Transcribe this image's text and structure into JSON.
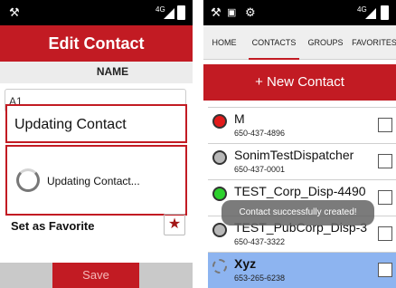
{
  "left_screen": {
    "status": {
      "app_icon": "tool-icon",
      "network": "4G"
    },
    "header_title": "Edit Contact",
    "section_label": "NAME",
    "name_field_value": "A1",
    "dialog": {
      "title": "Updating Contact",
      "message": "Updating Contact..."
    },
    "favorite_label": "Set as Favorite",
    "save_label": "Save"
  },
  "right_screen": {
    "status": {
      "network": "4G"
    },
    "tabs": [
      "HOME",
      "CONTACTS",
      "GROUPS",
      "FAVORITES"
    ],
    "active_tab": "CONTACTS",
    "new_contact_label": "+ New Contact",
    "contacts": [
      {
        "name": "M",
        "number": "650-437-4896",
        "status_color": "#e21b1b"
      },
      {
        "name": "SonimTestDispatcher",
        "number": "650-437-0001",
        "status_color": "#b8b8b8"
      },
      {
        "name": "TEST_Corp_Disp-4490",
        "number": "",
        "status_color": "#2ed12e"
      },
      {
        "name": "TEST_PubCorp_Disp-3",
        "number": "650-437-3322",
        "status_color": "#b8b8b8"
      },
      {
        "name": "Xyz",
        "number": "653-265-6238",
        "status_color": "loading"
      }
    ],
    "toast": "Contact successfully created!"
  },
  "colors": {
    "accent": "#c21b23",
    "selected_row": "#8db4f0"
  }
}
